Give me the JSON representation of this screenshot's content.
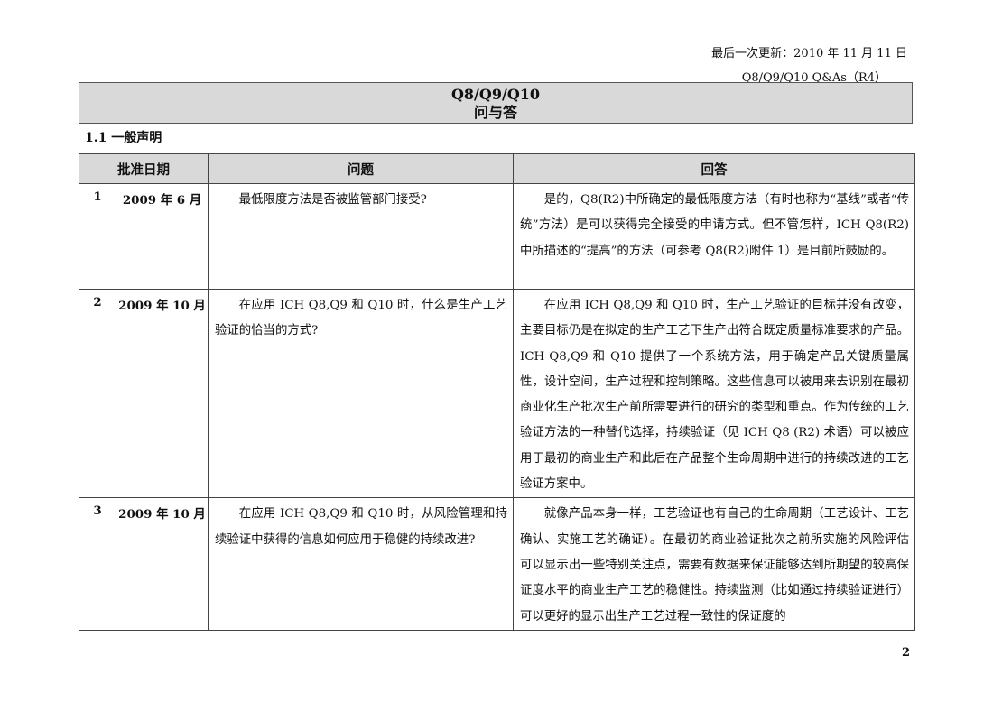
{
  "header": {
    "last_updated": "最后一次更新：2010 年 11 月 11 日",
    "doc_ref": "Q8/Q9/Q10 Q&As（R4）"
  },
  "title": {
    "line1": "Q8/Q9/Q10",
    "line2": "问与答"
  },
  "section_heading": "1.1 一般声明",
  "table": {
    "columns": [
      "批准日期",
      "问题",
      "回答"
    ],
    "rows": [
      {
        "num": "1",
        "date": "2009 年 6 月",
        "question": "最低限度方法是否被监管部门接受?",
        "answer": "是的，Q8(R2)中所确定的最低限度方法（有时也称为“基线”或者“传统”方法）是可以获得完全接受的申请方式。但不管怎样，ICH Q8(R2)中所描述的“提高”的方法（可参考 Q8(R2)附件 1）是目前所鼓励的。"
      },
      {
        "num": "2",
        "date": "2009 年 10 月",
        "question": "在应用 ICH Q8,Q9 和 Q10 时，什么是生产工艺验证的恰当的方式?",
        "answer": "在应用 ICH Q8,Q9 和 Q10 时，生产工艺验证的目标并没有改变，主要目标仍是在拟定的生产工艺下生产出符合既定质量标准要求的产品。ICH Q8,Q9 和 Q10 提供了一个系统方法，用于确定产品关键质量属性，设计空间，生产过程和控制策略。这些信息可以被用来去识别在最初商业化生产批次生产前所需要进行的研究的类型和重点。作为传统的工艺验证方法的一种替代选择，持续验证（见 ICH Q8 (R2) 术语）可以被应用于最初的商业生产和此后在产品整个生命周期中进行的持续改进的工艺验证方案中。"
      },
      {
        "num": "3",
        "date": "2009 年 10 月",
        "question": "在应用 ICH Q8,Q9 和 Q10 时，从风险管理和持续验证中获得的信息如何应用于稳健的持续改进?",
        "answer": "就像产品本身一样，工艺验证也有自己的生命周期（工艺设计、工艺确认、实施工艺的确证）。在最初的商业验证批次之前所实施的风险评估可以显示出一些特别关注点，需要有数据来保证能够达到所期望的较高保证度水平的商业生产工艺的稳健性。持续监测（比如通过持续验证进行）可以更好的显示出生产工艺过程一致性的保证度的"
      }
    ]
  },
  "page_number": "2"
}
